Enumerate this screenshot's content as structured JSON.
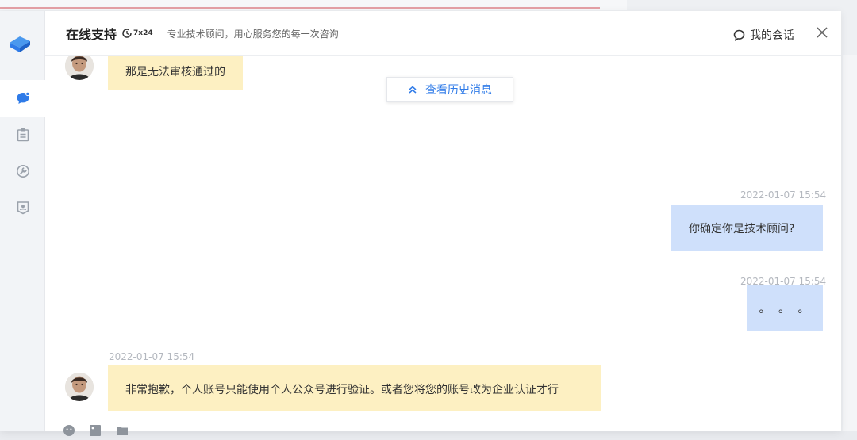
{
  "header": {
    "title": "在线支持",
    "badge": "7x24",
    "subtitle": "专业技术顾问，用心服务您的每一次咨询",
    "my_sessions": "我的会话"
  },
  "chat": {
    "history_button": "查看历史消息",
    "messages": [
      {
        "side": "left",
        "text": "那是无法审核通过的",
        "time": ""
      },
      {
        "side": "right",
        "text": "你确定你是技术顾问?",
        "time": "2022-01-07 15:54"
      },
      {
        "side": "right",
        "text": "。 。 。",
        "time": "2022-01-07 15:54"
      },
      {
        "side": "left",
        "text": "非常抱歉，个人账号只能使用个人公众号进行验证。或者您将您的账号改为企业认证才行",
        "time": "2022-01-07 15:54"
      }
    ]
  },
  "colors": {
    "accent": "#2f7be8",
    "agent_bubble": "#fdf0c2",
    "user_bubble": "#cfe0fb"
  },
  "icons": {
    "rail": [
      "chat-icon",
      "clipboard-icon",
      "wrench-icon",
      "badge-icon"
    ],
    "toolbar": [
      "emoji-icon",
      "image-icon",
      "folder-icon"
    ]
  }
}
